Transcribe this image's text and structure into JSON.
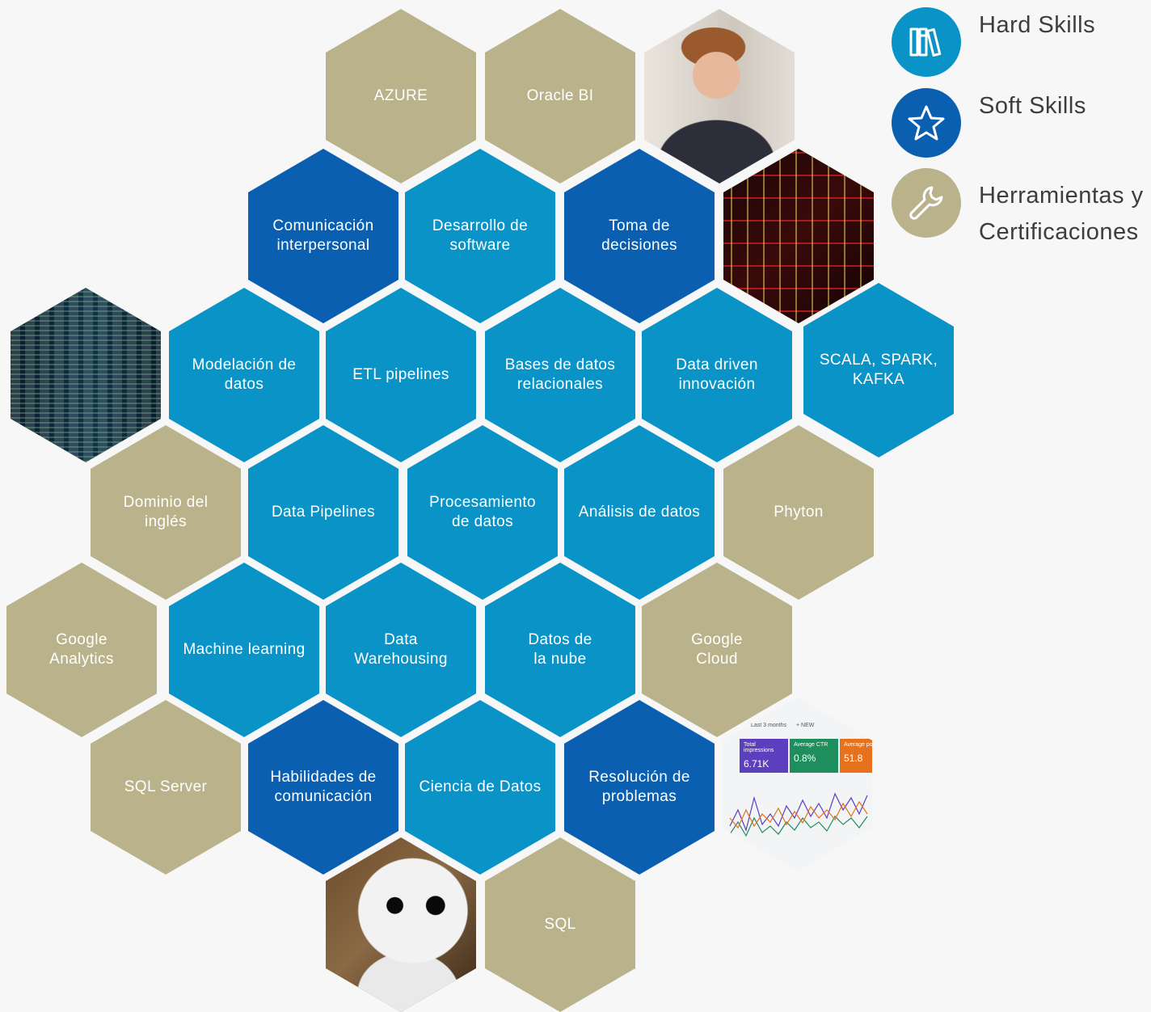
{
  "legend": {
    "hard": {
      "label": "Hard Skills",
      "color": "#0a93c6",
      "icon": "books-icon"
    },
    "soft": {
      "label": "Soft Skills",
      "color": "#0a5fb0",
      "icon": "star-icon"
    },
    "tools": {
      "label": "Herramientas y\nCertificaciones",
      "color": "#b9b28a",
      "icon": "wrench-icon"
    }
  },
  "hexagons": {
    "azure": "AZURE",
    "oracle_bi": "Oracle BI",
    "comunicacion_interpersonal": "Comunicación\ninterpersonal",
    "desarrollo_software": "Desarrollo de\nsoftware",
    "toma_decisiones": "Toma de decisiones",
    "modelacion_datos": "Modelación de\ndatos",
    "etl_pipelines": "ETL pipelines",
    "bases_datos_relacionales": "Bases de datos\nrelacionales",
    "data_driven": "Data driven\ninnovación",
    "scala_spark_kafka": "SCALA, SPARK,\nKAFKA",
    "dominio_ingles": "Dominio del inglés",
    "data_pipelines": "Data Pipelines",
    "procesamiento_datos": "Procesamiento\nde datos",
    "analisis_datos": "Análisis de datos",
    "phyton": "Phyton",
    "google_analytics": "Google\nAnalytics",
    "machine_learning": "Machine learning",
    "data_warehousing": "Data\nWarehousing",
    "datos_nube": "Datos de\nla nube",
    "google_cloud": "Google\nCloud",
    "sql_server": "SQL Server",
    "habilidades_comunicacion": "Habilidades de\ncomunicación",
    "ciencia_datos": "Ciencia de Datos",
    "resolucion_problemas": "Resolución de\nproblemas",
    "sql": "SQL"
  },
  "analytics_photo": {
    "range": "Last 3 months",
    "new": "+ NEW",
    "impressions_label": "Total impressions",
    "impressions_value": "6.71K",
    "ctr_label": "Average CTR",
    "ctr_value": "0.8%",
    "position_label": "Average pos",
    "position_value": "51.8"
  }
}
